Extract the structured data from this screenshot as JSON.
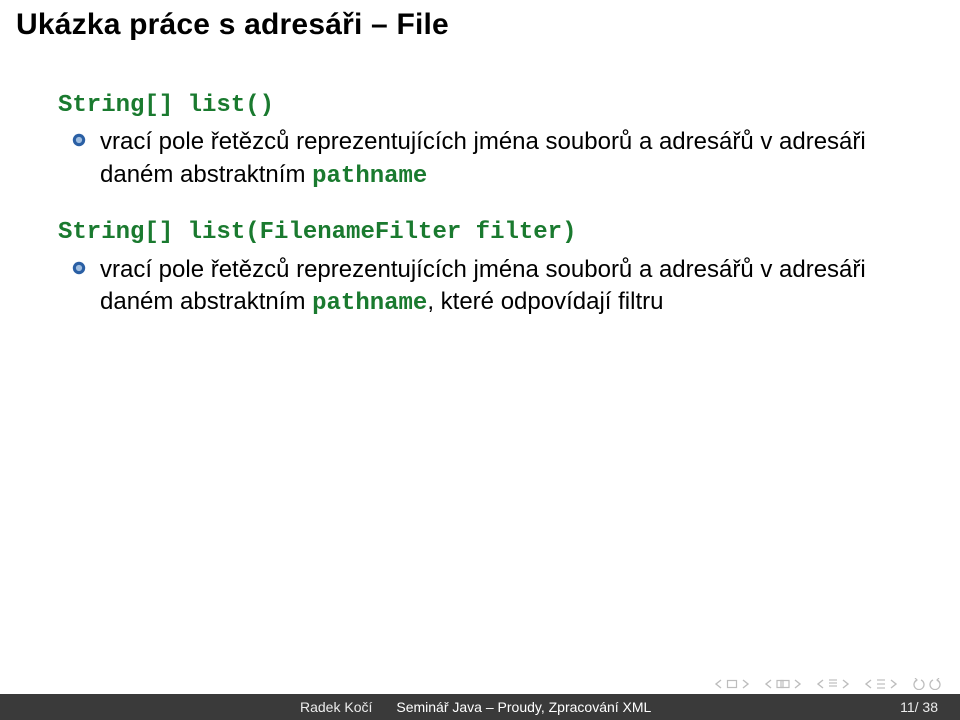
{
  "title": "Ukázka práce s adresáři – File",
  "blocks": [
    {
      "signature": "String[] list()",
      "bullet": {
        "pre": "vrací pole řetězců reprezentujících jména souborů a adresářů v adresáři daném abstraktním ",
        "code": "pathname",
        "post": ""
      }
    },
    {
      "signature": "String[] list(FilenameFilter filter)",
      "bullet": {
        "pre": "vrací pole řetězců reprezentujících jména souborů a adresářů v adresáři daném abstraktním ",
        "code": "pathname",
        "post": ", které odpovídají filtru"
      }
    }
  ],
  "footer": {
    "author": "Radek Kočí",
    "talk": "Seminář Java – Proudy, Zpracování XML",
    "page": "11/ 38"
  }
}
